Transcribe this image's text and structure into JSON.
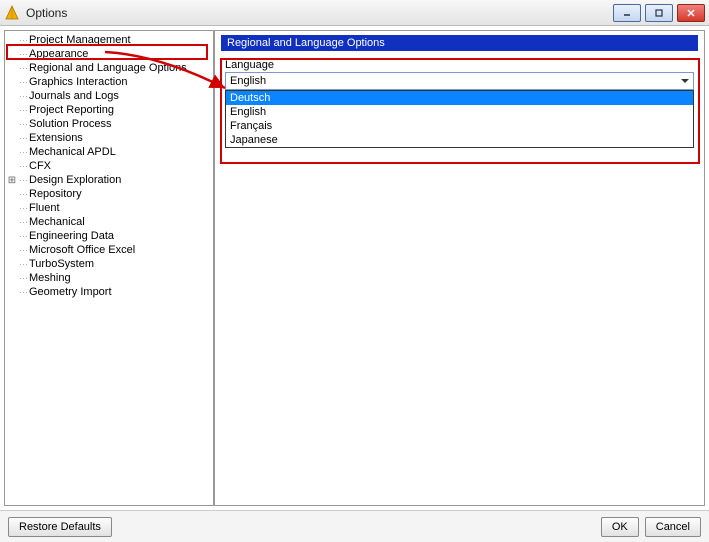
{
  "window": {
    "title": "Options"
  },
  "tree": {
    "items": [
      {
        "label": "Project Management",
        "expandable": false
      },
      {
        "label": "Appearance",
        "expandable": false
      },
      {
        "label": "Regional and Language Options",
        "expandable": false
      },
      {
        "label": "Graphics Interaction",
        "expandable": false
      },
      {
        "label": "Journals and Logs",
        "expandable": false
      },
      {
        "label": "Project Reporting",
        "expandable": false
      },
      {
        "label": "Solution Process",
        "expandable": false
      },
      {
        "label": "Extensions",
        "expandable": false
      },
      {
        "label": "Mechanical APDL",
        "expandable": false
      },
      {
        "label": "CFX",
        "expandable": false
      },
      {
        "label": "Design Exploration",
        "expandable": true
      },
      {
        "label": "Repository",
        "expandable": false
      },
      {
        "label": "Fluent",
        "expandable": false
      },
      {
        "label": "Mechanical",
        "expandable": false
      },
      {
        "label": "Engineering Data",
        "expandable": false
      },
      {
        "label": "Microsoft Office Excel",
        "expandable": false
      },
      {
        "label": "TurboSystem",
        "expandable": false
      },
      {
        "label": "Meshing",
        "expandable": false
      },
      {
        "label": "Geometry Import",
        "expandable": false
      }
    ]
  },
  "panel": {
    "header": "Regional and Language Options",
    "language_label": "Language",
    "language_value": "English",
    "language_options": [
      "Deutsch",
      "English",
      "Français",
      "Japanese"
    ],
    "language_selected_option": "Deutsch"
  },
  "buttons": {
    "restore_defaults": "Restore Defaults",
    "ok": "OK",
    "cancel": "Cancel"
  }
}
